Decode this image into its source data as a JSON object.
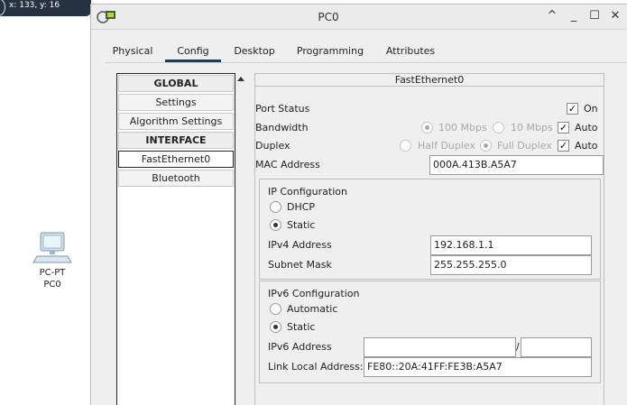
{
  "workspace": {
    "coords": "x: 133, y: 16",
    "device": {
      "model": "PC-PT",
      "name": "PC0"
    }
  },
  "window": {
    "title": "PC0",
    "controls": {
      "restore": "^",
      "minimize": "_",
      "maximize": "☐",
      "close": "✕"
    }
  },
  "tabs": [
    {
      "label": "Physical",
      "active": false
    },
    {
      "label": "Config",
      "active": true
    },
    {
      "label": "Desktop",
      "active": false
    },
    {
      "label": "Programming",
      "active": false
    },
    {
      "label": "Attributes",
      "active": false
    }
  ],
  "nav": {
    "global_header": "GLOBAL",
    "settings": "Settings",
    "algorithm_settings": "Algorithm Settings",
    "interface_header": "INTERFACE",
    "fastethernet": "FastEthernet0",
    "bluetooth": "Bluetooth"
  },
  "panel": {
    "title": "FastEthernet0",
    "port_status": {
      "label": "Port Status",
      "on_label": "On",
      "on_checked": true
    },
    "bandwidth": {
      "label": "Bandwidth",
      "opt1": "100 Mbps",
      "opt2": "10 Mbps",
      "auto_label": "Auto",
      "auto_checked": true
    },
    "duplex": {
      "label": "Duplex",
      "opt1": "Half Duplex",
      "opt2": "Full Duplex",
      "auto_label": "Auto",
      "auto_checked": true
    },
    "mac": {
      "label": "MAC Address",
      "value": "000A.413B.A5A7"
    },
    "ipv4": {
      "title": "IP Configuration",
      "dhcp": "DHCP",
      "static": "Static",
      "selected": "Static",
      "address_label": "IPv4 Address",
      "address": "192.168.1.1",
      "mask_label": "Subnet Mask",
      "mask": "255.255.255.0"
    },
    "ipv6": {
      "title": "IPv6 Configuration",
      "automatic": "Automatic",
      "static": "Static",
      "selected": "Static",
      "address_label": "IPv6 Address",
      "address": "",
      "separator": "/",
      "prefix": "",
      "link_local_label": "Link Local Address:",
      "link_local": "FE80::20A:41FF:FE3B:A5A7"
    }
  },
  "colors": {
    "tab_underline": "#1e3a5a",
    "workspace_bar": "#26323f"
  }
}
